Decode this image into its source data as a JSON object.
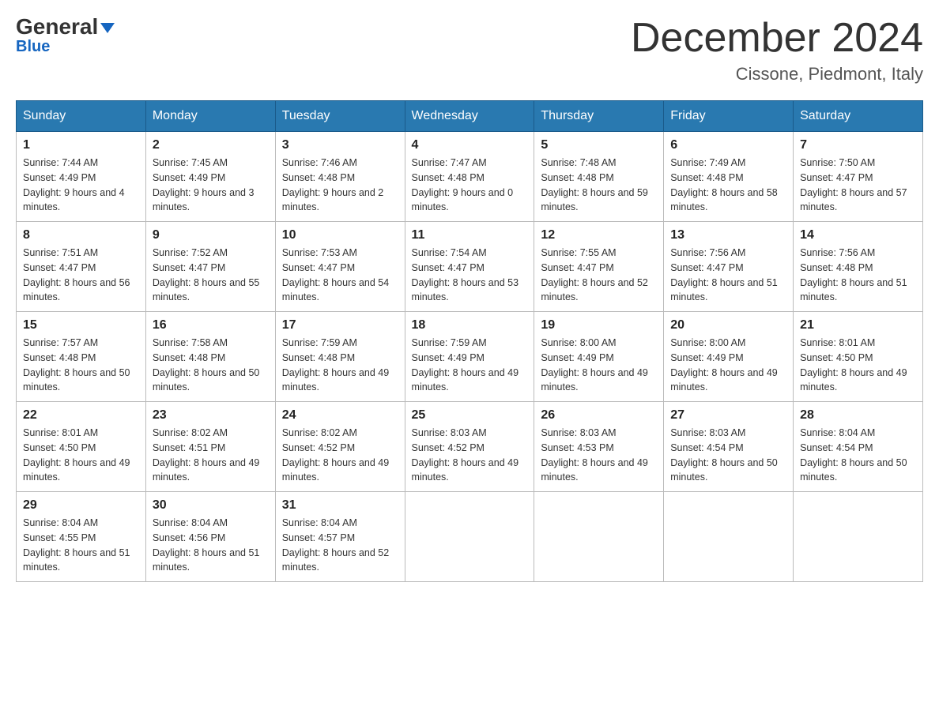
{
  "header": {
    "logo_general": "General",
    "logo_blue": "Blue",
    "month_title": "December 2024",
    "subtitle": "Cissone, Piedmont, Italy"
  },
  "days_of_week": [
    "Sunday",
    "Monday",
    "Tuesday",
    "Wednesday",
    "Thursday",
    "Friday",
    "Saturday"
  ],
  "weeks": [
    [
      {
        "day": 1,
        "sunrise": "7:44 AM",
        "sunset": "4:49 PM",
        "daylight": "9 hours and 4 minutes."
      },
      {
        "day": 2,
        "sunrise": "7:45 AM",
        "sunset": "4:49 PM",
        "daylight": "9 hours and 3 minutes."
      },
      {
        "day": 3,
        "sunrise": "7:46 AM",
        "sunset": "4:48 PM",
        "daylight": "9 hours and 2 minutes."
      },
      {
        "day": 4,
        "sunrise": "7:47 AM",
        "sunset": "4:48 PM",
        "daylight": "9 hours and 0 minutes."
      },
      {
        "day": 5,
        "sunrise": "7:48 AM",
        "sunset": "4:48 PM",
        "daylight": "8 hours and 59 minutes."
      },
      {
        "day": 6,
        "sunrise": "7:49 AM",
        "sunset": "4:48 PM",
        "daylight": "8 hours and 58 minutes."
      },
      {
        "day": 7,
        "sunrise": "7:50 AM",
        "sunset": "4:47 PM",
        "daylight": "8 hours and 57 minutes."
      }
    ],
    [
      {
        "day": 8,
        "sunrise": "7:51 AM",
        "sunset": "4:47 PM",
        "daylight": "8 hours and 56 minutes."
      },
      {
        "day": 9,
        "sunrise": "7:52 AM",
        "sunset": "4:47 PM",
        "daylight": "8 hours and 55 minutes."
      },
      {
        "day": 10,
        "sunrise": "7:53 AM",
        "sunset": "4:47 PM",
        "daylight": "8 hours and 54 minutes."
      },
      {
        "day": 11,
        "sunrise": "7:54 AM",
        "sunset": "4:47 PM",
        "daylight": "8 hours and 53 minutes."
      },
      {
        "day": 12,
        "sunrise": "7:55 AM",
        "sunset": "4:47 PM",
        "daylight": "8 hours and 52 minutes."
      },
      {
        "day": 13,
        "sunrise": "7:56 AM",
        "sunset": "4:47 PM",
        "daylight": "8 hours and 51 minutes."
      },
      {
        "day": 14,
        "sunrise": "7:56 AM",
        "sunset": "4:48 PM",
        "daylight": "8 hours and 51 minutes."
      }
    ],
    [
      {
        "day": 15,
        "sunrise": "7:57 AM",
        "sunset": "4:48 PM",
        "daylight": "8 hours and 50 minutes."
      },
      {
        "day": 16,
        "sunrise": "7:58 AM",
        "sunset": "4:48 PM",
        "daylight": "8 hours and 50 minutes."
      },
      {
        "day": 17,
        "sunrise": "7:59 AM",
        "sunset": "4:48 PM",
        "daylight": "8 hours and 49 minutes."
      },
      {
        "day": 18,
        "sunrise": "7:59 AM",
        "sunset": "4:49 PM",
        "daylight": "8 hours and 49 minutes."
      },
      {
        "day": 19,
        "sunrise": "8:00 AM",
        "sunset": "4:49 PM",
        "daylight": "8 hours and 49 minutes."
      },
      {
        "day": 20,
        "sunrise": "8:00 AM",
        "sunset": "4:49 PM",
        "daylight": "8 hours and 49 minutes."
      },
      {
        "day": 21,
        "sunrise": "8:01 AM",
        "sunset": "4:50 PM",
        "daylight": "8 hours and 49 minutes."
      }
    ],
    [
      {
        "day": 22,
        "sunrise": "8:01 AM",
        "sunset": "4:50 PM",
        "daylight": "8 hours and 49 minutes."
      },
      {
        "day": 23,
        "sunrise": "8:02 AM",
        "sunset": "4:51 PM",
        "daylight": "8 hours and 49 minutes."
      },
      {
        "day": 24,
        "sunrise": "8:02 AM",
        "sunset": "4:52 PM",
        "daylight": "8 hours and 49 minutes."
      },
      {
        "day": 25,
        "sunrise": "8:03 AM",
        "sunset": "4:52 PM",
        "daylight": "8 hours and 49 minutes."
      },
      {
        "day": 26,
        "sunrise": "8:03 AM",
        "sunset": "4:53 PM",
        "daylight": "8 hours and 49 minutes."
      },
      {
        "day": 27,
        "sunrise": "8:03 AM",
        "sunset": "4:54 PM",
        "daylight": "8 hours and 50 minutes."
      },
      {
        "day": 28,
        "sunrise": "8:04 AM",
        "sunset": "4:54 PM",
        "daylight": "8 hours and 50 minutes."
      }
    ],
    [
      {
        "day": 29,
        "sunrise": "8:04 AM",
        "sunset": "4:55 PM",
        "daylight": "8 hours and 51 minutes."
      },
      {
        "day": 30,
        "sunrise": "8:04 AM",
        "sunset": "4:56 PM",
        "daylight": "8 hours and 51 minutes."
      },
      {
        "day": 31,
        "sunrise": "8:04 AM",
        "sunset": "4:57 PM",
        "daylight": "8 hours and 52 minutes."
      },
      null,
      null,
      null,
      null
    ]
  ]
}
